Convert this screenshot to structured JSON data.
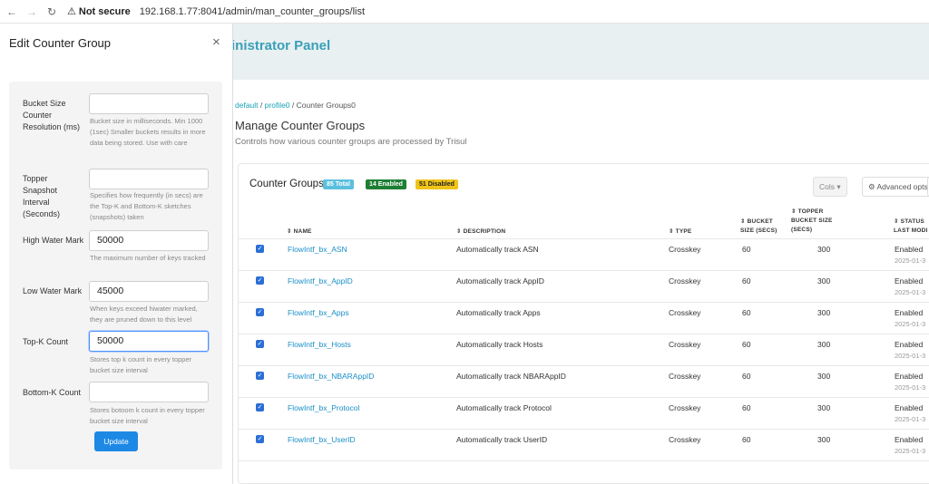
{
  "browser": {
    "back": "←",
    "forward": "→",
    "reload": "↻",
    "warning_icon": "⚠",
    "not_secure": "Not secure",
    "url": "192.168.1.77:8041/admin/man_counter_groups/list"
  },
  "admin": {
    "title": "inistrator Panel",
    "breadcrumb": {
      "item1": "default",
      "sep1": "/",
      "item2": "profile0",
      "sep2": "/",
      "item3": "Counter Groups0"
    },
    "heading": "Manage Counter Groups",
    "subheading": "Controls how various counter groups are processed by Trisul"
  },
  "card": {
    "title": "Counter Groups",
    "badge_total": "85 Total",
    "badge_enabled": "14 Enabled",
    "badge_disabled": "51 Disabled",
    "cols_button": "Cols ▾",
    "advanced_button": "⚙ Advanced opts"
  },
  "table": {
    "headers": {
      "name": "⇕ NAME",
      "description": "⇕ DESCRIPTION",
      "type": "⇕ TYPE",
      "bucket": "⇕ BUCKET SIZE (SECS)",
      "topper": "⇕ TOPPER BUCKET SIZE (SECS)",
      "status": "⇕ STATUS LAST MODI"
    },
    "rows": [
      {
        "name": "FlowIntf_bx_ASN",
        "description": "Automatically track ASN",
        "type": "Crosskey",
        "bucket": "60",
        "topper": "300",
        "status": "Enabled",
        "date": "2025-01-3"
      },
      {
        "name": "FlowIntf_bx_AppID",
        "description": "Automatically track AppID",
        "type": "Crosskey",
        "bucket": "60",
        "topper": "300",
        "status": "Enabled",
        "date": "2025-01-3"
      },
      {
        "name": "FlowIntf_bx_Apps",
        "description": "Automatically track Apps",
        "type": "Crosskey",
        "bucket": "60",
        "topper": "300",
        "status": "Enabled",
        "date": "2025-01-3"
      },
      {
        "name": "FlowIntf_bx_Hosts",
        "description": "Automatically track Hosts",
        "type": "Crosskey",
        "bucket": "60",
        "topper": "300",
        "status": "Enabled",
        "date": "2025-01-3"
      },
      {
        "name": "FlowIntf_bx_NBARAppID",
        "description": "Automatically track NBARAppID",
        "type": "Crosskey",
        "bucket": "60",
        "topper": "300",
        "status": "Enabled",
        "date": "2025-01-3"
      },
      {
        "name": "FlowIntf_bx_Protocol",
        "description": "Automatically track Protocol",
        "type": "Crosskey",
        "bucket": "60",
        "topper": "300",
        "status": "Enabled",
        "date": "2025-01-3"
      },
      {
        "name": "FlowIntf_bx_UserID",
        "description": "Automatically track UserID",
        "type": "Crosskey",
        "bucket": "60",
        "topper": "300",
        "status": "Enabled",
        "date": "2025-01-3"
      }
    ]
  },
  "edit": {
    "title": "Edit Counter Group",
    "close": "×",
    "fields": [
      {
        "label": "Bucket Size Counter Resolution (ms)",
        "value": "",
        "help": "Bucket size in milliseconds. Min 1000 (1sec) Smaller buckets results in more data being stored. Use with care"
      },
      {
        "label": "Topper Snapshot Interval (Seconds)",
        "value": "",
        "help": "Specifies how frequently (in secs) are the Top-K and Bottom-K sketches (snapshots) taken"
      },
      {
        "label": "High Water Mark",
        "value": "50000",
        "help": "The maximum number of keys tracked"
      },
      {
        "label": "Low Water Mark",
        "value": "45000",
        "help": "When keys exceed hiwater marked, they are pruned down to this level"
      },
      {
        "label": "Top-K Count",
        "value": "50000",
        "help": "Stores top k count in every topper bucket size interval"
      },
      {
        "label": "Bottom-K Count",
        "value": "",
        "help": "Stores botoom k count in every topper bucket size interval"
      }
    ],
    "update_button": "Update"
  }
}
